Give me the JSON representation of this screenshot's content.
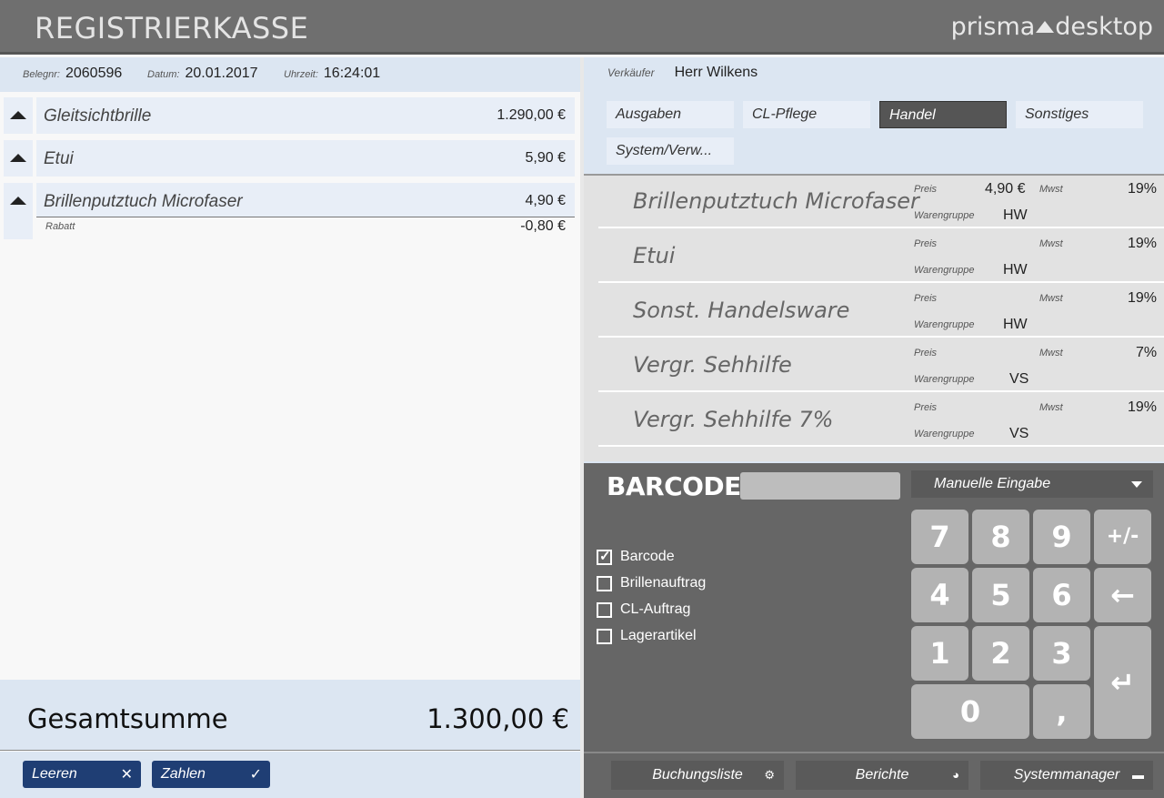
{
  "header": {
    "title": "REGISTRIERKASSE",
    "brand_left": "prisma",
    "brand_right": "desktop"
  },
  "receipt": {
    "belegnr_label": "Belegnr:",
    "belegnr": "2060596",
    "datum_label": "Datum:",
    "datum": "20.01.2017",
    "uhrzeit_label": "Uhrzeit:",
    "uhrzeit": "16:24:01",
    "items": [
      {
        "name": "Gleitsichtbrille",
        "price": "1.290,00 €"
      },
      {
        "name": "Etui",
        "price": "5,90 €"
      },
      {
        "name": "Brillenputztuch Microfaser",
        "price": "4,90 €",
        "discount_label": "Rabatt",
        "discount": "-0,80 €"
      }
    ],
    "total_label": "Gesamtsumme",
    "total": "1.300,00 €",
    "buttons": {
      "clear": "Leeren",
      "pay": "Zahlen"
    }
  },
  "seller": {
    "label": "Verkäufer",
    "name": "Herr Wilkens"
  },
  "categories": [
    "Ausgaben",
    "CL-Pflege",
    "Handel",
    "Sonstiges",
    "System/Verw..."
  ],
  "active_category": "Handel",
  "product_labels": {
    "price": "Preis",
    "vat": "Mwst",
    "group": "Warengruppe"
  },
  "products": [
    {
      "name": "Brillenputztuch Microfaser",
      "price": "4,90 €",
      "vat": "19%",
      "group": "HW"
    },
    {
      "name": "Etui",
      "price": "",
      "vat": "19%",
      "group": "HW"
    },
    {
      "name": "Sonst. Handelsware",
      "price": "",
      "vat": "19%",
      "group": "HW"
    },
    {
      "name": "Vergr. Sehhilfe",
      "price": "",
      "vat": "7%",
      "group": "VS"
    },
    {
      "name": "Vergr. Sehhilfe 7%",
      "price": "",
      "vat": "19%",
      "group": "VS"
    }
  ],
  "barcode": {
    "title": "BARCODE",
    "input_value": "",
    "mode": "Manuelle Eingabe",
    "options": [
      {
        "label": "Barcode",
        "checked": true
      },
      {
        "label": "Brillenauftrag",
        "checked": false
      },
      {
        "label": "CL-Auftrag",
        "checked": false
      },
      {
        "label": "Lagerartikel",
        "checked": false
      }
    ]
  },
  "keypad": [
    "7",
    "8",
    "9",
    "+/-",
    "4",
    "5",
    "6",
    "←",
    "1",
    "2",
    "3",
    "↵",
    "0",
    ","
  ],
  "footer": {
    "bookings": "Buchungsliste",
    "reports": "Berichte",
    "system": "Systemmanager"
  }
}
